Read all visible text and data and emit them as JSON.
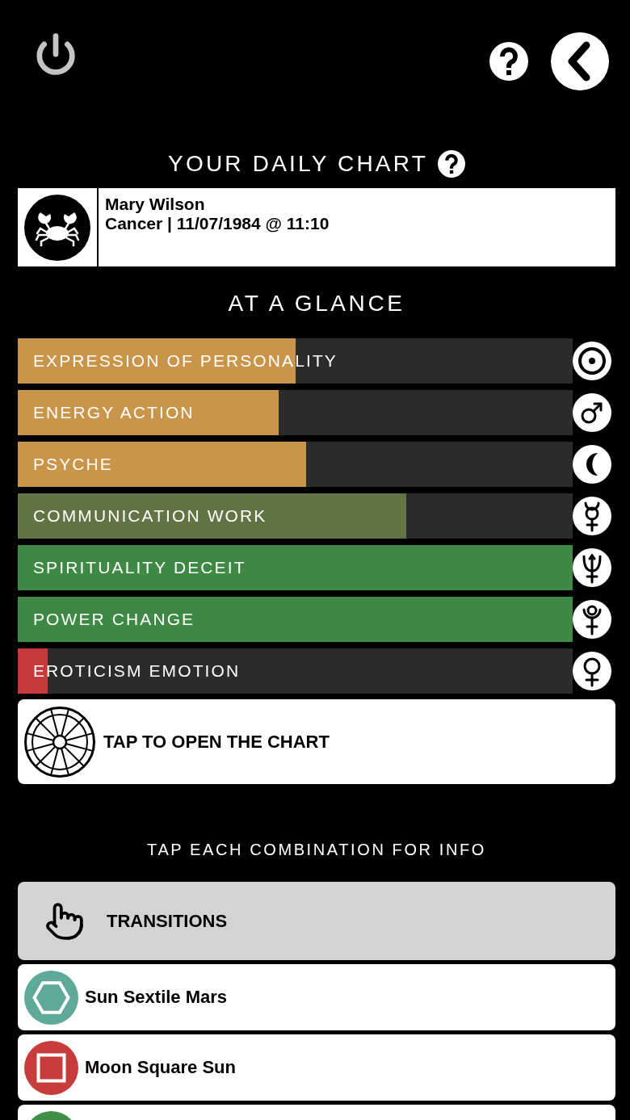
{
  "title": "YOUR DAILY CHART",
  "profile": {
    "name": "Mary Wilson",
    "details": "Cancer | 11/07/1984 @ 11:10"
  },
  "glance": {
    "title": "AT A GLANCE",
    "bars": [
      {
        "label": "EXPRESSION OF PERSONALITY",
        "level": 0.5,
        "color": "#c8954a",
        "kind": "sun"
      },
      {
        "label": "ENERGY ACTION",
        "level": 0.47,
        "color": "#c8954a",
        "kind": "mars"
      },
      {
        "label": "PSYCHE",
        "level": 0.52,
        "color": "#c8954a",
        "kind": "moon"
      },
      {
        "label": "COMMUNICATION WORK",
        "level": 0.7,
        "color": "#617443",
        "kind": "mercury"
      },
      {
        "label": "SPIRITUALITY DECEIT",
        "level": 1,
        "color": "#3e8a44",
        "kind": "neptune"
      },
      {
        "label": "POWER CHANGE",
        "level": 1,
        "color": "#3e8a44",
        "kind": "pluto"
      },
      {
        "label": "EROTICISM EMOTION",
        "level": 0.054,
        "color": "#c83a3a",
        "kind": "venus"
      }
    ]
  },
  "chart_button": {
    "label": "TAP TO OPEN THE CHART"
  },
  "combinations": {
    "title": "TAP EACH COMBINATION FOR INFO",
    "header": "TRANSITIONS",
    "items": [
      {
        "label": "Sun Sextile Mars",
        "kind": "sextile",
        "color": "#5fa99b"
      },
      {
        "label": "Moon Square Sun",
        "kind": "square",
        "color": "#c83c3c"
      },
      {
        "kind": "other",
        "color": "#3f8f47"
      }
    ]
  }
}
